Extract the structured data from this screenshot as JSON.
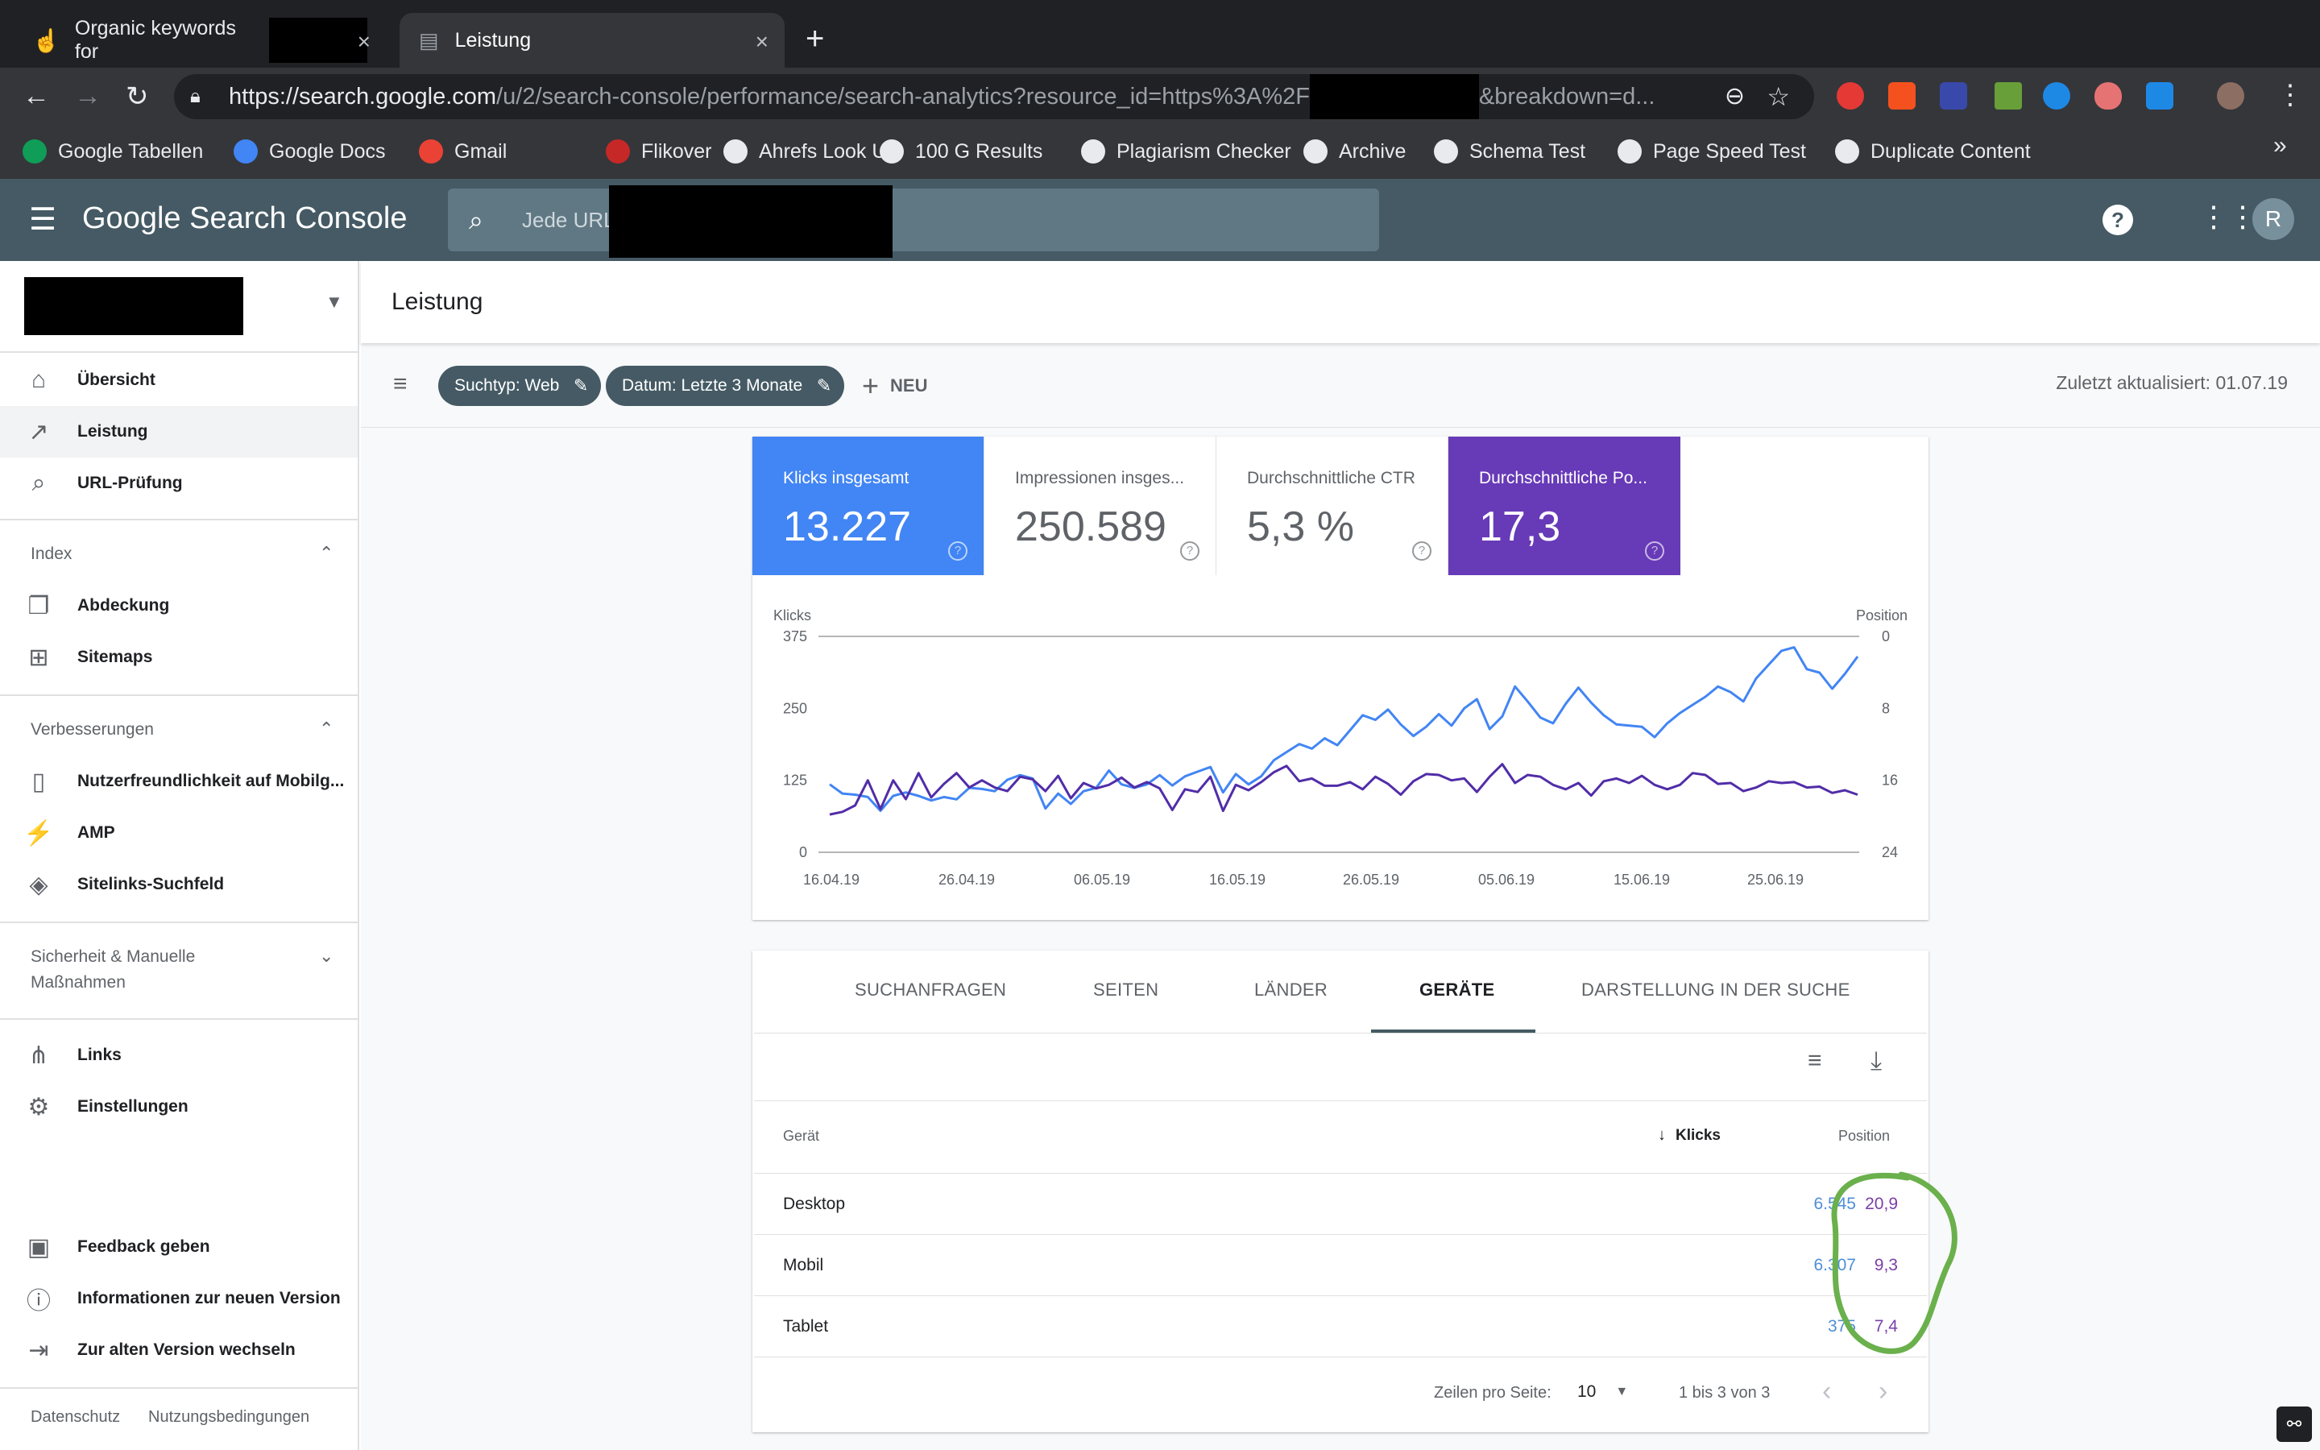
{
  "browser": {
    "tabs": [
      {
        "title": "Organic keywords for",
        "active": false
      },
      {
        "title": "Leistung",
        "active": true
      }
    ],
    "url_host": "https://search.google.com",
    "url_path": "/u/2/search-console/performance/search-analytics?resource_id=https%3A%2F",
    "url_tail": "&breakdown=d...",
    "bookmarks": [
      {
        "label": "Google Tabellen",
        "color": "#0f9d58"
      },
      {
        "label": "Google Docs",
        "color": "#4285f4"
      },
      {
        "label": "Gmail",
        "color": "#ea4335"
      },
      {
        "label": "Flikover",
        "color": "#c62828"
      },
      {
        "label": "Ahrefs Look Up",
        "color": "#e8eaed"
      },
      {
        "label": "100 G Results",
        "color": "#e8eaed"
      },
      {
        "label": "Plagiarism Checker",
        "color": "#e8eaed"
      },
      {
        "label": "Archive",
        "color": "#e8eaed"
      },
      {
        "label": "Schema Test",
        "color": "#e8eaed"
      },
      {
        "label": "Page Speed Test",
        "color": "#e8eaed"
      },
      {
        "label": "Duplicate Content",
        "color": "#e8eaed"
      }
    ],
    "bookmarks_more": "»"
  },
  "header": {
    "logo_google": "Google",
    "logo_product": "Search Console",
    "search_placeholder": "Jede URL",
    "avatar_letter": "R"
  },
  "sidebar": {
    "nav": [
      {
        "label": "Übersicht",
        "icon": "⌂"
      },
      {
        "label": "Leistung",
        "icon": "↗"
      },
      {
        "label": "URL-Prüfung",
        "icon": "⌕"
      }
    ],
    "index_title": "Index",
    "index_items": [
      {
        "label": "Abdeckung",
        "icon": "❐"
      },
      {
        "label": "Sitemaps",
        "icon": "⊞"
      }
    ],
    "improvements_title": "Verbesserungen",
    "improvements_items": [
      {
        "label": "Nutzerfreundlichkeit auf Mobilg...",
        "icon": "▯"
      },
      {
        "label": "AMP",
        "icon": "⚡"
      },
      {
        "label": "Sitelinks-Suchfeld",
        "icon": "◈"
      }
    ],
    "security_title_1": "Sicherheit & Manuelle",
    "security_title_2": "Maßnahmen",
    "other_items": [
      {
        "label": "Links",
        "icon": "⋔"
      },
      {
        "label": "Einstellungen",
        "icon": "⚙"
      }
    ],
    "footer_items": [
      {
        "label": "Feedback geben",
        "icon": "▣"
      },
      {
        "label": "Informationen zur neuen Version",
        "icon": "ⓘ"
      },
      {
        "label": "Zur alten Version wechseln",
        "icon": "⇥"
      }
    ],
    "privacy": "Datenschutz",
    "terms": "Nutzungsbedingungen"
  },
  "page": {
    "title": "Leistung",
    "filters": [
      "Suchtyp: Web",
      "Datum: Letzte 3 Monate"
    ],
    "new_label": "NEU",
    "updated": "Zuletzt aktualisiert: 01.07.19"
  },
  "metrics": [
    {
      "label": "Klicks insgesamt",
      "value": "13.227",
      "bg": "#4285f4",
      "fg": "#ffffff"
    },
    {
      "label": "Impressionen insges...",
      "value": "250.589",
      "bg": "#ffffff",
      "fg": "#5f6368"
    },
    {
      "label": "Durchschnittliche CTR",
      "value": "5,3 %",
      "bg": "#ffffff",
      "fg": "#5f6368"
    },
    {
      "label": "Durchschnittliche Po...",
      "value": "17,3",
      "bg": "#673ab7",
      "fg": "#ffffff"
    }
  ],
  "chart_data": {
    "type": "line",
    "left_axis_label": "Klicks",
    "right_axis_label": "Position",
    "left_ticks": [
      "375",
      "250",
      "125",
      "0"
    ],
    "right_ticks": [
      "0",
      "8",
      "16",
      "24"
    ],
    "left_ylim": [
      0,
      375
    ],
    "right_ylim": [
      24,
      0
    ],
    "x_labels": [
      "16.04.19",
      "26.04.19",
      "06.05.19",
      "16.05.19",
      "26.05.19",
      "05.06.19",
      "15.06.19",
      "25.06.19"
    ],
    "series": [
      {
        "name": "Klicks",
        "color": "#4285f4",
        "axis": "left",
        "values": [
          118,
          102,
          100,
          96,
          72,
          98,
          104,
          98,
          90,
          96,
          92,
          112,
          110,
          106,
          126,
          134,
          128,
          76,
          102,
          84,
          106,
          112,
          142,
          118,
          112,
          118,
          134,
          116,
          132,
          140,
          148,
          104,
          136,
          118,
          132,
          160,
          174,
          188,
          180,
          198,
          186,
          212,
          238,
          230,
          248,
          222,
          202,
          218,
          240,
          220,
          250,
          266,
          214,
          236,
          288,
          262,
          234,
          224,
          258,
          286,
          260,
          238,
          222,
          220,
          218,
          200,
          224,
          242,
          256,
          270,
          288,
          278,
          262,
          302,
          326,
          350,
          356,
          318,
          312,
          284,
          310,
          340
        ]
      },
      {
        "name": "Position",
        "color": "#512da8",
        "axis": "right",
        "values": [
          19.8,
          19.5,
          18.8,
          16.0,
          19.2,
          16.0,
          18.1,
          15.2,
          17.9,
          16.4,
          15.2,
          16.8,
          16.0,
          16.8,
          17.2,
          15.6,
          15.9,
          17.2,
          15.5,
          18.0,
          16.3,
          16.9,
          16.5,
          15.7,
          16.8,
          16.2,
          16.9,
          19.3,
          17.0,
          17.3,
          15.6,
          19.4,
          16.5,
          17.1,
          16.2,
          15.1,
          14.4,
          16.1,
          15.8,
          16.6,
          16.6,
          16.2,
          17.0,
          15.6,
          16.4,
          17.6,
          16.1,
          15.3,
          15.4,
          16.0,
          15.8,
          17.3,
          15.6,
          14.2,
          16.3,
          15.4,
          15.6,
          16.5,
          17.0,
          16.3,
          17.7,
          16.1,
          15.8,
          16.3,
          15.5,
          16.5,
          17.0,
          16.5,
          15.2,
          15.4,
          16.4,
          16.3,
          17.2,
          16.8,
          16.1,
          16.3,
          16.2,
          16.8,
          16.7,
          17.4,
          17.1,
          17.6
        ]
      }
    ]
  },
  "table": {
    "tabs": [
      "SUCHANFRAGEN",
      "SEITEN",
      "LÄNDER",
      "GERÄTE",
      "DARSTELLUNG IN DER SUCHE"
    ],
    "active_tab": "GERÄTE",
    "col_device": "Gerät",
    "col_clicks": "Klicks",
    "col_position": "Position",
    "rows": [
      {
        "device": "Desktop",
        "clicks": "6.545",
        "position": "20,9"
      },
      {
        "device": "Mobil",
        "clicks": "6.307",
        "position": "9,3"
      },
      {
        "device": "Tablet",
        "clicks": "375",
        "position": "7,4"
      }
    ],
    "rows_per_page_label": "Zeilen pro Seite:",
    "rows_per_page": "10",
    "range": "1 bis 3 von 3"
  },
  "colors": {
    "clicks_accent": "#4285f4",
    "position_accent": "#673ab7",
    "annotation": "#6ab04c"
  }
}
